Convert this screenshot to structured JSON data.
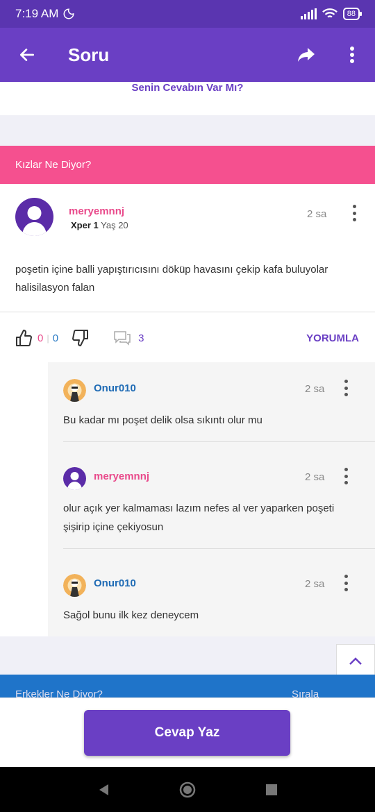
{
  "status_bar": {
    "time": "7:19 AM",
    "battery": "88"
  },
  "app_bar": {
    "title": "Soru"
  },
  "answer_prompt": "Senin Cevabın Var Mı?",
  "girls_section": {
    "title": "Kızlar Ne Diyor?"
  },
  "answer": {
    "author": "meryemnnj",
    "xper_label": "Xper 1",
    "age": "Yaş 20",
    "time": "2 sa",
    "text": "poşetin içine balli yapıştırıcısını döküp havasını çekip kafa buluyolar halisilasyon falan",
    "likes": "0",
    "dislikes": "0",
    "comments_count": "3",
    "reply_label": "YORUMLA"
  },
  "comments": [
    {
      "author": "Onur010",
      "time": "2 sa",
      "text": "Bu kadar mı poşet delik olsa sıkıntı olur mu",
      "author_color": "#1f6bb5"
    },
    {
      "author": "meryemnnj",
      "time": "2 sa",
      "text": "olur açık yer kalmaması lazım nefes al ver yaparken poşeti şişirip içine çekiyosun",
      "author_color": "#e94a8b"
    },
    {
      "author": "Onur010",
      "time": "2 sa",
      "text": "Sağol bunu ilk kez deneycem",
      "author_color": "#1f6bb5"
    }
  ],
  "boys_section": {
    "title": "Erkekler Ne Diyor?",
    "sort_label": "Sırala"
  },
  "bottom": {
    "answer_button": "Cevap Yaz"
  },
  "colors": {
    "primary": "#6a3fc4",
    "pink": "#f5508f",
    "blue": "#1f74c9"
  }
}
